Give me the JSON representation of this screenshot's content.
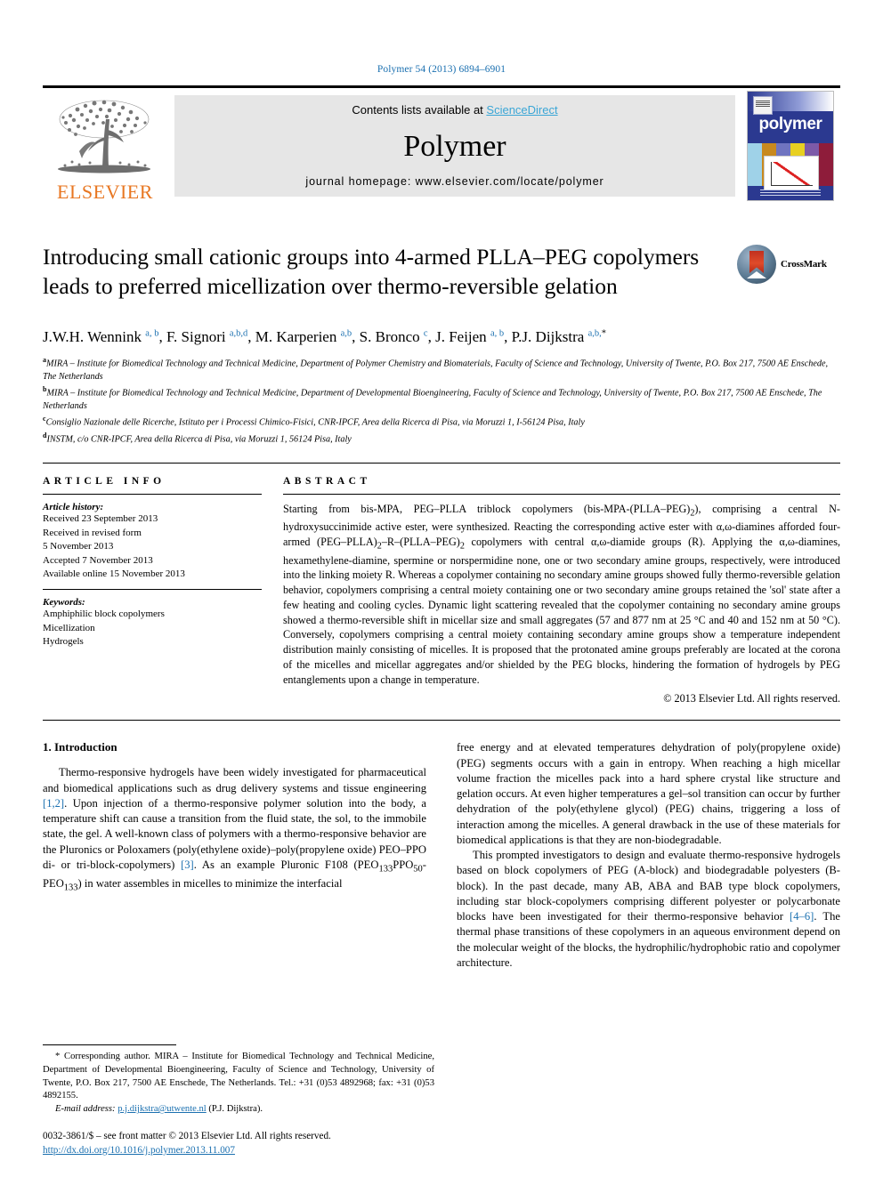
{
  "running_head": "Polymer 54 (2013) 6894–6901",
  "masthead": {
    "publisher": "ELSEVIER",
    "contents_prefix": "Contents lists available at ",
    "contents_link": "ScienceDirect",
    "journal_name": "Polymer",
    "homepage": "journal homepage: www.elsevier.com/locate/polymer",
    "cover_title": "polymer"
  },
  "article": {
    "title": "Introducing small cationic groups into 4-armed PLLA–PEG copolymers leads to preferred micellization over thermo-reversible gelation",
    "crossmark_label": "CrossMark",
    "authors_html": "J.W.H. Wennink <sup>a, b</sup>, F. Signori <sup>a,b,d</sup>, M. Karperien <sup>a,b</sup>, S. Bronco <sup>c</sup>, J. Feijen <sup>a, b</sup>, P.J. Dijkstra <sup>a,b,</sup><sup class=\"star\">*</sup>",
    "affiliations": [
      "MIRA – Institute for Biomedical Technology and Technical Medicine, Department of Polymer Chemistry and Biomaterials, Faculty of Science and Technology, University of Twente, P.O. Box 217, 7500 AE Enschede, The Netherlands",
      "MIRA – Institute for Biomedical Technology and Technical Medicine, Department of Developmental Bioengineering, Faculty of Science and Technology, University of Twente, P.O. Box 217, 7500 AE Enschede, The Netherlands",
      "Consiglio Nazionale delle Ricerche, Istituto per i Processi Chimico-Fisici, CNR-IPCF, Area della Ricerca di Pisa, via Moruzzi 1, I-56124 Pisa, Italy",
      "INSTM, c/o CNR-IPCF, Area della Ricerca di Pisa, via Moruzzi 1, 56124 Pisa, Italy"
    ],
    "affiliation_marks": [
      "a",
      "b",
      "c",
      "d"
    ]
  },
  "article_info": {
    "heading": "ARTICLE INFO",
    "history_label": "Article history:",
    "history": [
      "Received 23 September 2013",
      "Received in revised form",
      "5 November 2013",
      "Accepted 7 November 2013",
      "Available online 15 November 2013"
    ],
    "keywords_label": "Keywords:",
    "keywords": [
      "Amphiphilic block copolymers",
      "Micellization",
      "Hydrogels"
    ]
  },
  "abstract": {
    "heading": "ABSTRACT",
    "text": "Starting from bis-MPA, PEG–PLLA triblock copolymers (bis-MPA-(PLLA–PEG)2), comprising a central N-hydroxysuccinimide active ester, were synthesized. Reacting the corresponding active ester with α,ω-diamines afforded four-armed (PEG–PLLA)2–R–(PLLA–PEG)2 copolymers with central α,ω-diamide groups (R). Applying the α,ω-diamines, hexamethylene-diamine, spermine or norspermidine none, one or two secondary amine groups, respectively, were introduced into the linking moiety R. Whereas a copolymer containing no secondary amine groups showed fully thermo-reversible gelation behavior, copolymers comprising a central moiety containing one or two secondary amine groups retained the 'sol' state after a few heating and cooling cycles. Dynamic light scattering revealed that the copolymer containing no secondary amine groups showed a thermo-reversible shift in micellar size and small aggregates (57 and 877 nm at 25 °C and 40 and 152 nm at 50 °C). Conversely, copolymers comprising a central moiety containing secondary amine groups show a temperature independent distribution mainly consisting of micelles. It is proposed that the protonated amine groups preferably are located at the corona of the micelles and micellar aggregates and/or shielded by the PEG blocks, hindering the formation of hydrogels by PEG entanglements upon a change in temperature.",
    "copyright": "© 2013 Elsevier Ltd. All rights reserved."
  },
  "body": {
    "section_title": "1. Introduction",
    "left_paragraphs": [
      "Thermo-responsive hydrogels have been widely investigated for pharmaceutical and biomedical applications such as drug delivery systems and tissue engineering [1,2]. Upon injection of a thermo-responsive polymer solution into the body, a temperature shift can cause a transition from the fluid state, the sol, to the immobile state, the gel. A well-known class of polymers with a thermo-responsive behavior are the Pluronics or Poloxamers (poly(ethylene oxide)–poly(propylene oxide) PEO–PPO di- or tri-block-copolymers) [3]. As an example Pluronic F108 (PEO133PPO50-PEO133) in water assembles in micelles to minimize the interfacial"
    ],
    "right_paragraphs": [
      "free energy and at elevated temperatures dehydration of poly(propylene oxide) (PEG) segments occurs with a gain in entropy. When reaching a high micellar volume fraction the micelles pack into a hard sphere crystal like structure and gelation occurs. At even higher temperatures a gel–sol transition can occur by further dehydration of the poly(ethylene glycol) (PEG) chains, triggering a loss of interaction among the micelles. A general drawback in the use of these materials for biomedical applications is that they are non-biodegradable.",
      "This prompted investigators to design and evaluate thermo-responsive hydrogels based on block copolymers of PEG (A-block) and biodegradable polyesters (B-block). In the past decade, many AB, ABA and BAB type block copolymers, including star block-copolymers comprising different polyester or polycarbonate blocks have been investigated for their thermo-responsive behavior [4–6]. The thermal phase transitions of these copolymers in an aqueous environment depend on the molecular weight of the blocks, the hydrophilic/hydrophobic ratio and copolymer architecture."
    ]
  },
  "footnotes": {
    "corresponding": "* Corresponding author. MIRA – Institute for Biomedical Technology and Technical Medicine, Department of Developmental Bioengineering, Faculty of Science and Technology, University of Twente, P.O. Box 217, 7500 AE Enschede, The Netherlands. Tel.: +31 (0)53 4892968; fax: +31 (0)53 4892155.",
    "email_label": "E-mail address:",
    "email": "p.j.dijkstra@utwente.nl",
    "email_owner": "(P.J. Dijkstra).",
    "issn_line": "0032-3861/$ – see front matter © 2013 Elsevier Ltd. All rights reserved.",
    "doi": "http://dx.doi.org/10.1016/j.polymer.2013.11.007"
  },
  "colors": {
    "link": "#1b70b0",
    "elsevier_orange": "#e87722",
    "sciencedirect": "#3aa6d6"
  }
}
